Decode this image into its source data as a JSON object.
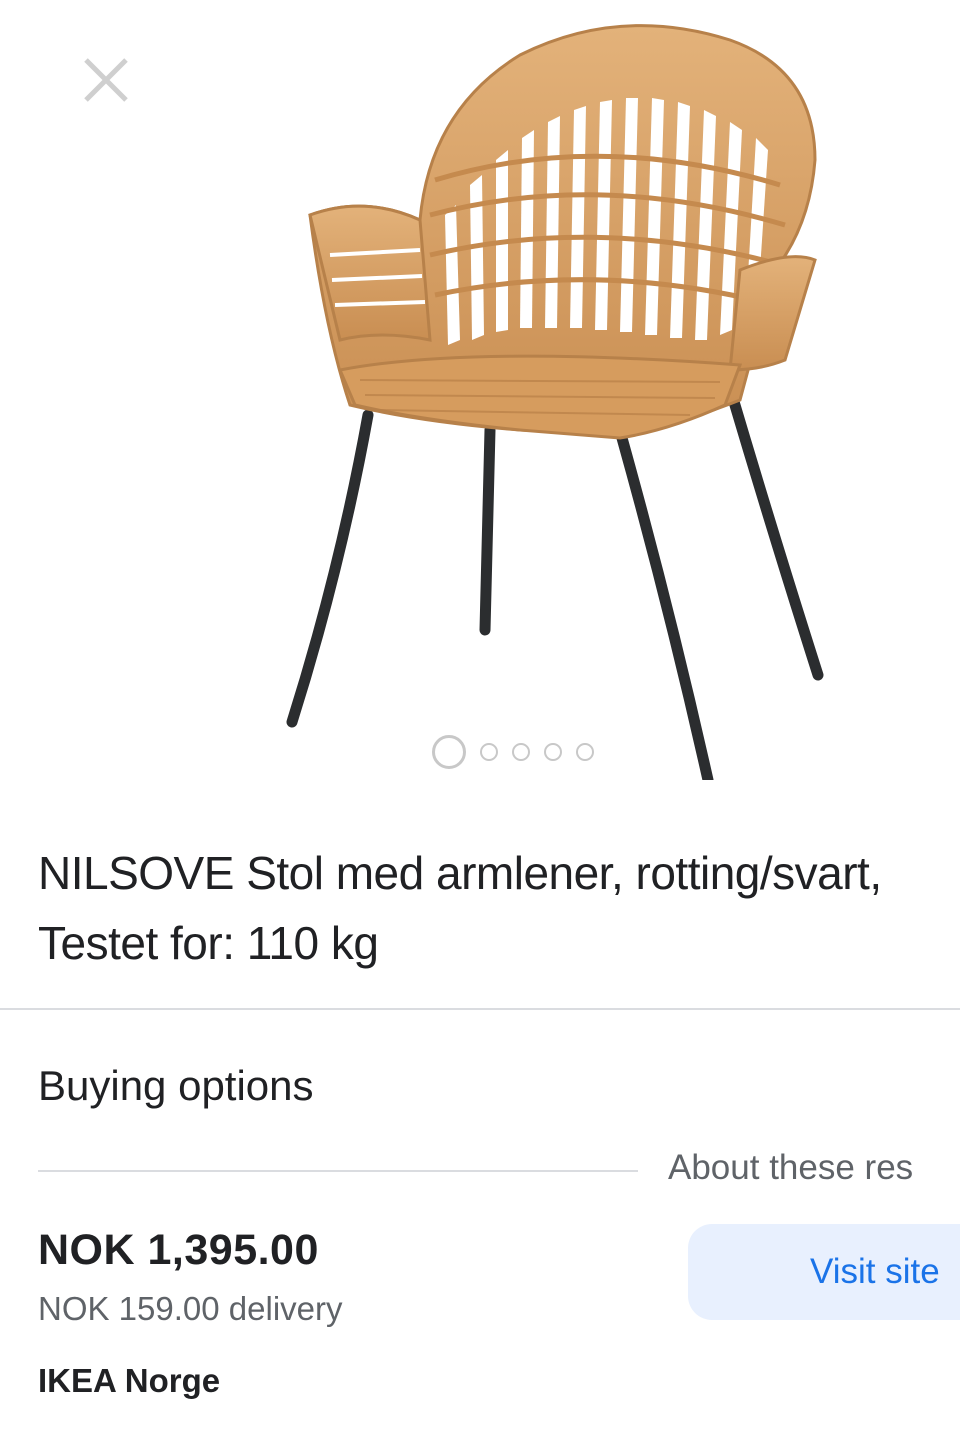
{
  "viewer": {
    "close_icon": "close-icon",
    "image_alt": "NILSOVE chair",
    "carousel": {
      "total": 5,
      "active_index": 0
    }
  },
  "product": {
    "title": "NILSOVE Stol med armlener, rotting/svart, Testet for: 110 kg"
  },
  "buying": {
    "heading": "Buying options",
    "about_label": "About these res",
    "offer": {
      "price": "NOK 1,395.00",
      "delivery": "NOK 159.00 delivery",
      "seller": "IKEA Norge",
      "visit_label": "Visit site"
    }
  },
  "colors": {
    "accent": "#1a73e8",
    "button_bg": "#e8f0fe",
    "rattan": "#d9a46a",
    "leg": "#2b2d2f"
  }
}
